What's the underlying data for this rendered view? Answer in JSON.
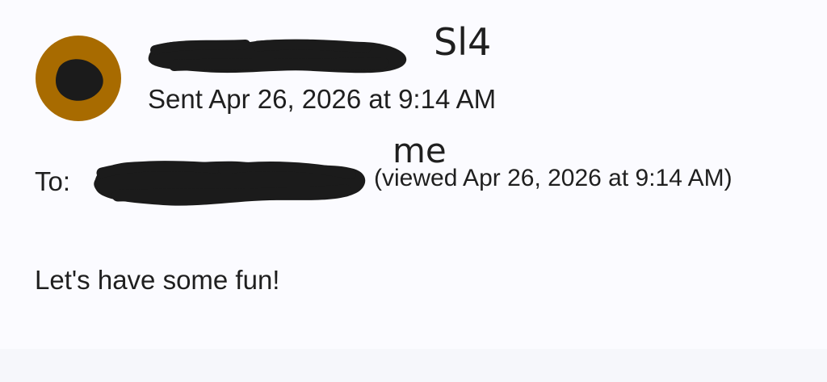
{
  "message": {
    "sent_text": "Sent Apr 26, 2026 at 9:14 AM",
    "to_label": "To:",
    "viewed_text": "(viewed Apr 26, 2026 at 9:14 AM)",
    "body_text": "Let's have some fun!"
  },
  "handwritten_notes": {
    "sender_note": "Sl4",
    "recipient_note": "me"
  },
  "colors": {
    "background": "#fbfbff",
    "avatar": "#a86b00",
    "redaction": "#1b1b1b",
    "text": "#1f1f1f"
  },
  "icons": {
    "avatar": "profile-avatar-icon"
  }
}
